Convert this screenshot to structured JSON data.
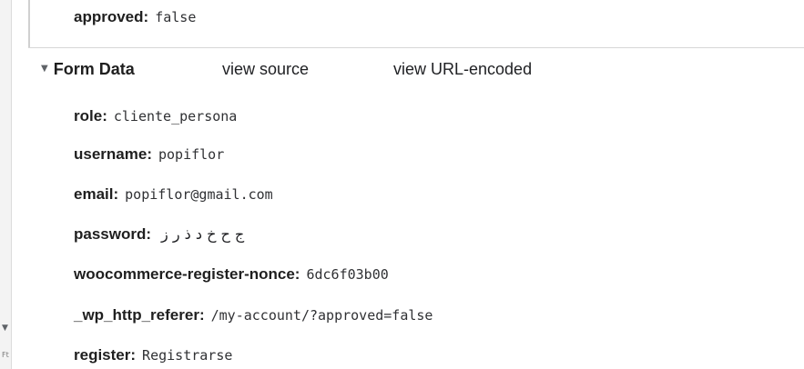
{
  "request": {
    "top_param": {
      "key": "approved",
      "value": "false"
    }
  },
  "form_data": {
    "title": "Form Data",
    "view_source_label": "view source",
    "view_url_encoded_label": "view URL-encoded",
    "items": [
      {
        "key": "role",
        "value": "cliente_persona"
      },
      {
        "key": "username",
        "value": "popiflor"
      },
      {
        "key": "email",
        "value": "popiflor@gmail.com"
      },
      {
        "key": "password",
        "value": "ج ح خ د ذ ر ز"
      },
      {
        "key": "woocommerce-register-nonce",
        "value": "6dc6f03b00"
      },
      {
        "key": "_wp_http_referer",
        "value": "/my-account/?approved=false"
      },
      {
        "key": "register",
        "value": "Registrarse"
      }
    ]
  },
  "ui": {
    "expand_icon": "triangle-down-icon",
    "gutter_icon": "scroll-arrow-down-icon",
    "gutter_fragment": "Ft"
  },
  "colors": {
    "text_primary": "#1f1f1f",
    "text_value": "#303134",
    "divider": "#d7d7d7",
    "gutter": "#f3f3f3"
  }
}
